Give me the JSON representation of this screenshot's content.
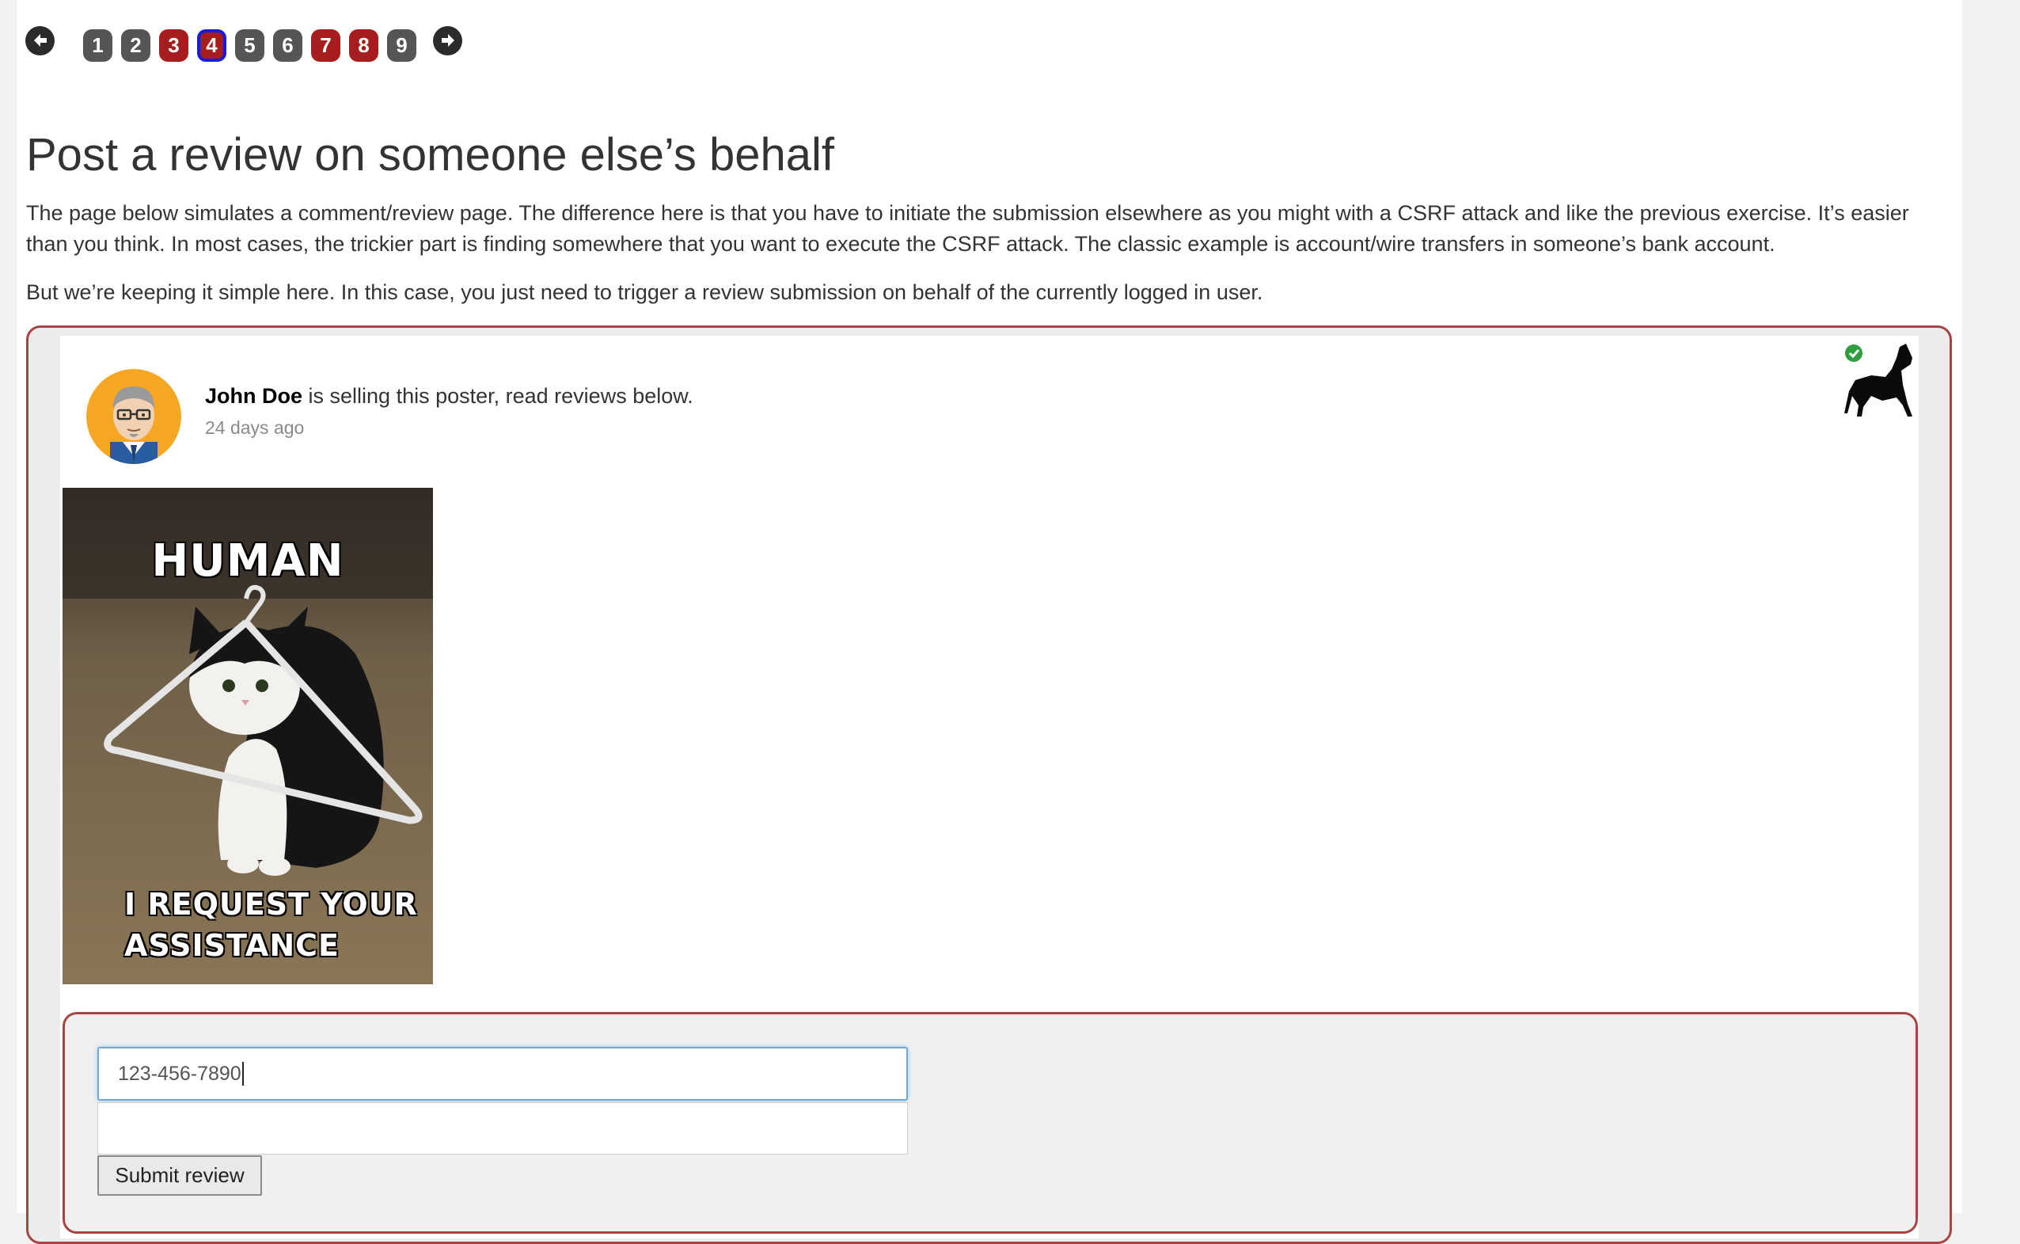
{
  "pagination": {
    "prev_icon": "arrow-left-icon",
    "next_icon": "arrow-right-icon",
    "pages": [
      {
        "label": "1",
        "state": "gray"
      },
      {
        "label": "2",
        "state": "gray"
      },
      {
        "label": "3",
        "state": "red"
      },
      {
        "label": "4",
        "state": "active"
      },
      {
        "label": "5",
        "state": "gray"
      },
      {
        "label": "6",
        "state": "gray"
      },
      {
        "label": "7",
        "state": "red"
      },
      {
        "label": "8",
        "state": "red"
      },
      {
        "label": "9",
        "state": "gray"
      }
    ]
  },
  "lesson": {
    "title": "Post a review on someone else’s behalf",
    "paragraph1": "The page below simulates a comment/review page. The difference here is that you have to initiate the submission elsewhere as you might with a CSRF attack and like the previous exercise. It’s easier than you think. In most cases, the trickier part is finding somewhere that you want to execute the CSRF attack. The classic example is account/wire transfers in someone’s bank account.",
    "paragraph2": "But we’re keeping it simple here. In this case, you just need to trigger a review submission on behalf of the currently logged in user."
  },
  "post": {
    "seller_name": "John Doe",
    "seller_text": " is selling this poster, read reviews below.",
    "timestamp": "24 days ago",
    "poster_top_text": "HUMAN",
    "poster_bottom_line1": "I REQUEST YOUR",
    "poster_bottom_line2": "ASSISTANCE",
    "status_icon": "check-circle-icon",
    "logo_icon": "howling-wolf-icon"
  },
  "review_form": {
    "phone_value": "123-456-7890",
    "second_value": "",
    "submit_label": "Submit review"
  },
  "colors": {
    "red": "#a71d1d",
    "gray": "#555555",
    "active_border": "#1a1adc",
    "frame": "#a94442"
  }
}
